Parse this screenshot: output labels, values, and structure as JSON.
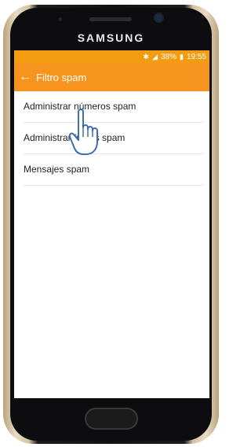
{
  "device": {
    "brand": "SAMSUNG"
  },
  "status_bar": {
    "battery": "38%",
    "time": "19:55",
    "icons": [
      "bluetooth-icon",
      "signal-icon",
      "battery-icon"
    ]
  },
  "app_bar": {
    "title": "Filtro spam",
    "back_icon": "back-arrow-icon"
  },
  "list": {
    "items": [
      {
        "label": "Administrar números spam"
      },
      {
        "label": "Administrar frases spam"
      },
      {
        "label": "Mensajes spam"
      }
    ]
  },
  "colors": {
    "accent": "#F7941D",
    "status_bar": "#F39C12"
  }
}
